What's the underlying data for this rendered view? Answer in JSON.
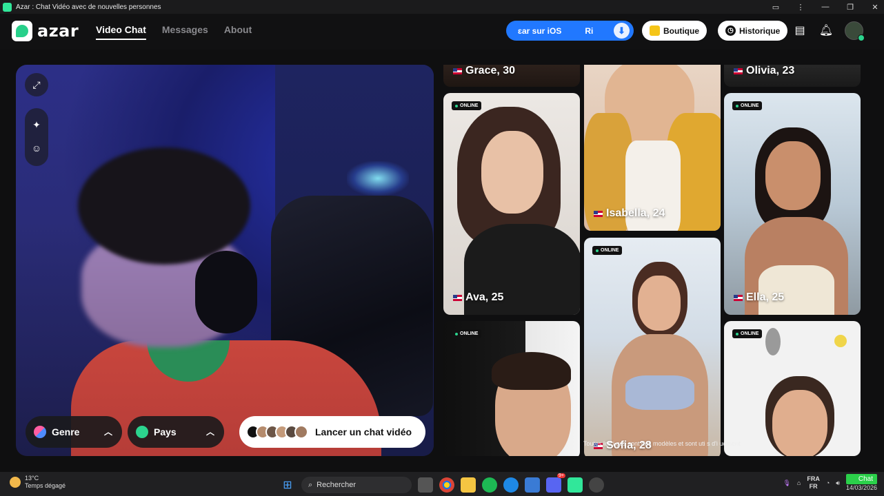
{
  "window": {
    "title": "Azar : Chat Vidéo avec de nouvelles personnes"
  },
  "header": {
    "logo_text": "azar",
    "nav": [
      {
        "label": "Video Chat",
        "active": true
      },
      {
        "label": "Messages",
        "active": false
      },
      {
        "label": "About",
        "active": false
      }
    ],
    "promo": {
      "text_left": "ɛar sur iOS",
      "text_right": "Ri"
    },
    "shop_label": "Boutique",
    "history_label": "Historique"
  },
  "video_panel": {
    "tools": [
      "expand-icon",
      "magic-wand-icon",
      "face-filter-icon"
    ],
    "gender_filter": "Genre",
    "country_filter": "Pays",
    "launch_button": "Lancer un chat vidéo"
  },
  "profiles": {
    "online_label": "ONLINE",
    "cards": [
      {
        "name": "Grace, 30",
        "online": false
      },
      {
        "name": "Olivia, 23",
        "online": false
      },
      {
        "name": "Ava, 25",
        "online": true
      },
      {
        "name": "Isabella, 24",
        "online": false
      },
      {
        "name": "Ella, 25",
        "online": true
      },
      {
        "name": "",
        "online": true
      },
      {
        "name": "Sofia, 28",
        "online": true
      },
      {
        "name": "",
        "online": true
      }
    ],
    "caption": "Toutes les i         ges sont des modèles et sont uti                    s d'i               uement"
  },
  "taskbar": {
    "weather_temp": "13°C",
    "weather_desc": "Temps dégagé",
    "search_placeholder": "Rechercher",
    "lang_top": "FRA",
    "lang_bottom": "FR",
    "date": "14/03/2026",
    "chat_badge": "Chat",
    "discord_badge": "9+"
  }
}
